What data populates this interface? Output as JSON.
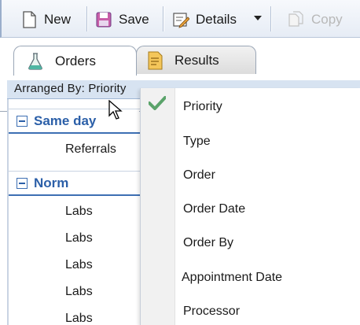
{
  "toolbar": {
    "new_label": "New",
    "save_label": "Save",
    "details_label": "Details",
    "copy_label": "Copy"
  },
  "tabs": [
    {
      "label": "Orders",
      "icon": "flask-icon",
      "active": true
    },
    {
      "label": "Results",
      "icon": "document-icon",
      "active": false
    }
  ],
  "arranged_by": "Arranged By: Priority",
  "groups": [
    {
      "title": "Same day",
      "items": [
        "Referrals"
      ]
    },
    {
      "title": "Norm",
      "items": [
        "Labs",
        "Labs",
        "Labs",
        "Labs",
        "Labs"
      ]
    }
  ],
  "menu": {
    "items": [
      "Priority",
      "Type",
      "Order",
      "Order Date",
      "Order By",
      "Appointment Date",
      "Processor"
    ],
    "checked": "Priority"
  },
  "colors": {
    "group_header": "#2b5fa8",
    "arranged_bar": "#d7e3f1",
    "check": "#5aa36a"
  }
}
